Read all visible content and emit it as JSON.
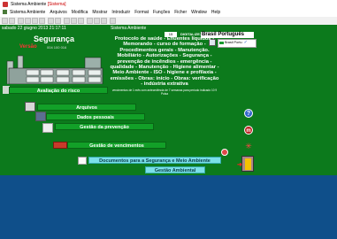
{
  "window": {
    "title": "Sistema Ambiente",
    "title_red": "[Sistema]"
  },
  "menubar": {
    "items": [
      "Sistema Ambiente",
      "Arquivos",
      "Modifica",
      "Mostrar",
      "Introduzir",
      "Format",
      "Funções",
      "Ficher",
      "Window",
      "Help"
    ]
  },
  "strip": {
    "date_text": "sabado 22 giugno 2013 21:17:11",
    "app_text": "Sistema Ambiente",
    "selector_value": "15",
    "digitalize_text": "DIGITALIZE.Z+17"
  },
  "left_panel": {
    "title": "Segurança",
    "version_label": "Versão",
    "version_nums": "004 100 016"
  },
  "info": {
    "text": "Protocolo de saúde - Efluentes líquidos - Memorando - curso de formação - Procedimentos gerais - Manutenção. Mobiliário - Autorizações - Segurança - prevenção de incêndios - emergência - qualidade - Manutenção - Higiene alimentar - Meio Ambiente - ISO - higiene e profilaxia - emissões - Obras: início - Obras: verificação - indústria extrativa",
    "small_text": "vencimentos de 1 mês com antecedência de 7 semanas para período indicado  10  9 Pulsa"
  },
  "language": {
    "label": "Brasil Português",
    "dropdown": "Brasil Portu"
  },
  "buttons": {
    "risk": "Avaliação do risco",
    "files": "Arquivos",
    "personal": "Dados pessoais",
    "prevention": "Gestão da prevenção",
    "expirations": "Gestão de vencimentos",
    "documents": "Documentos  para a Segurança e Meio Ambiente",
    "environment": "Gestão Ambiental"
  },
  "icons": {
    "help": "?",
    "m": "m",
    "sun": "✳"
  },
  "colors": {
    "primary_green": "#0c7a1c",
    "button_green": "#12a028",
    "bottom_blue": "#0f4f8a",
    "cyan_button": "#7be0e8"
  }
}
